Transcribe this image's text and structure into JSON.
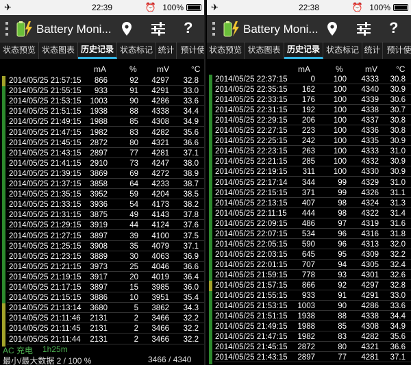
{
  "panels": {
    "left": {
      "status": {
        "time": "22:39",
        "battery": "100%"
      },
      "app_title": "Battery Moni...",
      "tabs": [
        "状态预览",
        "状态图表",
        "历史记录",
        "状态标记",
        "统计",
        "预计使"
      ],
      "active_tab": 2,
      "headers": {
        "ma": "mA",
        "pct": "%",
        "mv": "mV",
        "c": "°C"
      },
      "rows": [
        [
          "2014/05/25 21:57:15",
          "866",
          "92",
          "4297",
          "32.8",
          "y"
        ],
        [
          "2014/05/25 21:55:15",
          "933",
          "91",
          "4291",
          "33.0",
          "g"
        ],
        [
          "2014/05/25 21:53:15",
          "1003",
          "90",
          "4286",
          "33.6",
          "g"
        ],
        [
          "2014/05/25 21:51:15",
          "1938",
          "88",
          "4338",
          "34.4",
          "g"
        ],
        [
          "2014/05/25 21:49:15",
          "1988",
          "85",
          "4308",
          "34.9",
          "g"
        ],
        [
          "2014/05/25 21:47:15",
          "1982",
          "83",
          "4282",
          "35.6",
          "g"
        ],
        [
          "2014/05/25 21:45:15",
          "2872",
          "80",
          "4321",
          "36.6",
          "g"
        ],
        [
          "2014/05/25 21:43:15",
          "2897",
          "77",
          "4281",
          "37.1",
          "g"
        ],
        [
          "2014/05/25 21:41:15",
          "2910",
          "73",
          "4247",
          "38.0",
          "g"
        ],
        [
          "2014/05/25 21:39:15",
          "3869",
          "69",
          "4272",
          "38.9",
          "g"
        ],
        [
          "2014/05/25 21:37:15",
          "3858",
          "64",
          "4233",
          "38.7",
          "g"
        ],
        [
          "2014/05/25 21:35:15",
          "3952",
          "59",
          "4204",
          "38.5",
          "g"
        ],
        [
          "2014/05/25 21:33:15",
          "3936",
          "54",
          "4173",
          "38.2",
          "g"
        ],
        [
          "2014/05/25 21:31:15",
          "3875",
          "49",
          "4143",
          "37.8",
          "g"
        ],
        [
          "2014/05/25 21:29:15",
          "3919",
          "44",
          "4124",
          "37.6",
          "g"
        ],
        [
          "2014/05/25 21:27:15",
          "3897",
          "39",
          "4100",
          "37.5",
          "g"
        ],
        [
          "2014/05/25 21:25:15",
          "3908",
          "35",
          "4079",
          "37.1",
          "g"
        ],
        [
          "2014/05/25 21:23:15",
          "3889",
          "30",
          "4063",
          "36.9",
          "g"
        ],
        [
          "2014/05/25 21:21:15",
          "3973",
          "25",
          "4046",
          "36.6",
          "g"
        ],
        [
          "2014/05/25 21:19:15",
          "3917",
          "20",
          "4019",
          "36.4",
          "g"
        ],
        [
          "2014/05/25 21:17:15",
          "3897",
          "15",
          "3985",
          "36.0",
          "g"
        ],
        [
          "2014/05/25 21:15:15",
          "3886",
          "10",
          "3951",
          "35.4",
          "g"
        ],
        [
          "2014/05/25 21:13:14",
          "3680",
          "5",
          "3862",
          "34.3",
          "y"
        ],
        [
          "2014/05/25 21:11:46",
          "2131",
          "2",
          "3466",
          "32.2",
          "y"
        ],
        [
          "2014/05/25 21:11:45",
          "2131",
          "2",
          "3466",
          "32.2",
          "y"
        ],
        [
          "2014/05/25 21:11:44",
          "2131",
          "2",
          "3466",
          "32.2",
          "y"
        ]
      ],
      "footer": {
        "charge_type": "AC 充电",
        "charge_time": "1h25m",
        "minmax_label": "最小/最大数据 2 / 100 %",
        "voltage_range": "3466 / 4340 mV"
      }
    },
    "right": {
      "status": {
        "time": "22:38",
        "battery": "100%"
      },
      "app_title": "Battery Moni...",
      "tabs": [
        "状态预览",
        "状态图表",
        "历史记录",
        "状态标记",
        "统计",
        "预计使"
      ],
      "active_tab": 2,
      "headers": {
        "ma": "mA",
        "pct": "%",
        "mv": "mV",
        "c": "°C"
      },
      "rows": [
        [
          "2014/05/25 22:37:15",
          "0",
          "100",
          "4333",
          "30.8",
          "g"
        ],
        [
          "2014/05/25 22:35:15",
          "162",
          "100",
          "4340",
          "30.9",
          "g"
        ],
        [
          "2014/05/25 22:33:15",
          "176",
          "100",
          "4339",
          "30.6",
          "g"
        ],
        [
          "2014/05/25 22:31:15",
          "192",
          "100",
          "4338",
          "30.7",
          "g"
        ],
        [
          "2014/05/25 22:29:15",
          "206",
          "100",
          "4337",
          "30.8",
          "g"
        ],
        [
          "2014/05/25 22:27:15",
          "223",
          "100",
          "4336",
          "30.8",
          "g"
        ],
        [
          "2014/05/25 22:25:15",
          "242",
          "100",
          "4335",
          "30.9",
          "g"
        ],
        [
          "2014/05/25 22:23:15",
          "263",
          "100",
          "4333",
          "31.0",
          "g"
        ],
        [
          "2014/05/25 22:21:15",
          "285",
          "100",
          "4332",
          "30.9",
          "g"
        ],
        [
          "2014/05/25 22:19:15",
          "311",
          "100",
          "4330",
          "30.9",
          "g"
        ],
        [
          "2014/05/25 22:17:14",
          "344",
          "99",
          "4329",
          "31.0",
          "g"
        ],
        [
          "2014/05/25 22:15:15",
          "371",
          "99",
          "4326",
          "31.1",
          "g"
        ],
        [
          "2014/05/25 22:13:15",
          "407",
          "98",
          "4324",
          "31.3",
          "g"
        ],
        [
          "2014/05/25 22:11:15",
          "444",
          "98",
          "4322",
          "31.4",
          "g"
        ],
        [
          "2014/05/25 22:09:15",
          "486",
          "97",
          "4319",
          "31.6",
          "g"
        ],
        [
          "2014/05/25 22:07:15",
          "534",
          "96",
          "4316",
          "31.8",
          "g"
        ],
        [
          "2014/05/25 22:05:15",
          "590",
          "96",
          "4313",
          "32.0",
          "g"
        ],
        [
          "2014/05/25 22:03:15",
          "645",
          "95",
          "4309",
          "32.2",
          "g"
        ],
        [
          "2014/05/25 22:01:15",
          "707",
          "94",
          "4305",
          "32.4",
          "g"
        ],
        [
          "2014/05/25 21:59:15",
          "778",
          "93",
          "4301",
          "32.6",
          "g"
        ],
        [
          "2014/05/25 21:57:15",
          "866",
          "92",
          "4297",
          "32.8",
          "y"
        ],
        [
          "2014/05/25 21:55:15",
          "933",
          "91",
          "4291",
          "33.0",
          "g"
        ],
        [
          "2014/05/25 21:53:15",
          "1003",
          "90",
          "4286",
          "33.6",
          "g"
        ],
        [
          "2014/05/25 21:51:15",
          "1938",
          "88",
          "4338",
          "34.4",
          "g"
        ],
        [
          "2014/05/25 21:49:15",
          "1988",
          "85",
          "4308",
          "34.9",
          "g"
        ],
        [
          "2014/05/25 21:47:15",
          "1982",
          "83",
          "4282",
          "35.6",
          "g"
        ],
        [
          "2014/05/25 21:45:15",
          "2872",
          "80",
          "4321",
          "36.6",
          "g"
        ],
        [
          "2014/05/25 21:43:15",
          "2897",
          "77",
          "4281",
          "37.1",
          "g"
        ]
      ]
    }
  },
  "colors": {
    "accent_tab": "#33b5e5",
    "bar_green": "#2d8a2d",
    "bar_yellow": "#a3a32a",
    "footer_green": "#4caf50"
  },
  "icons": [
    "airplane-icon",
    "alarm-icon",
    "battery-icon",
    "overflow-dots-icon",
    "app-battery-icon",
    "location-pin-icon",
    "settings-sliders-icon",
    "help-icon"
  ]
}
